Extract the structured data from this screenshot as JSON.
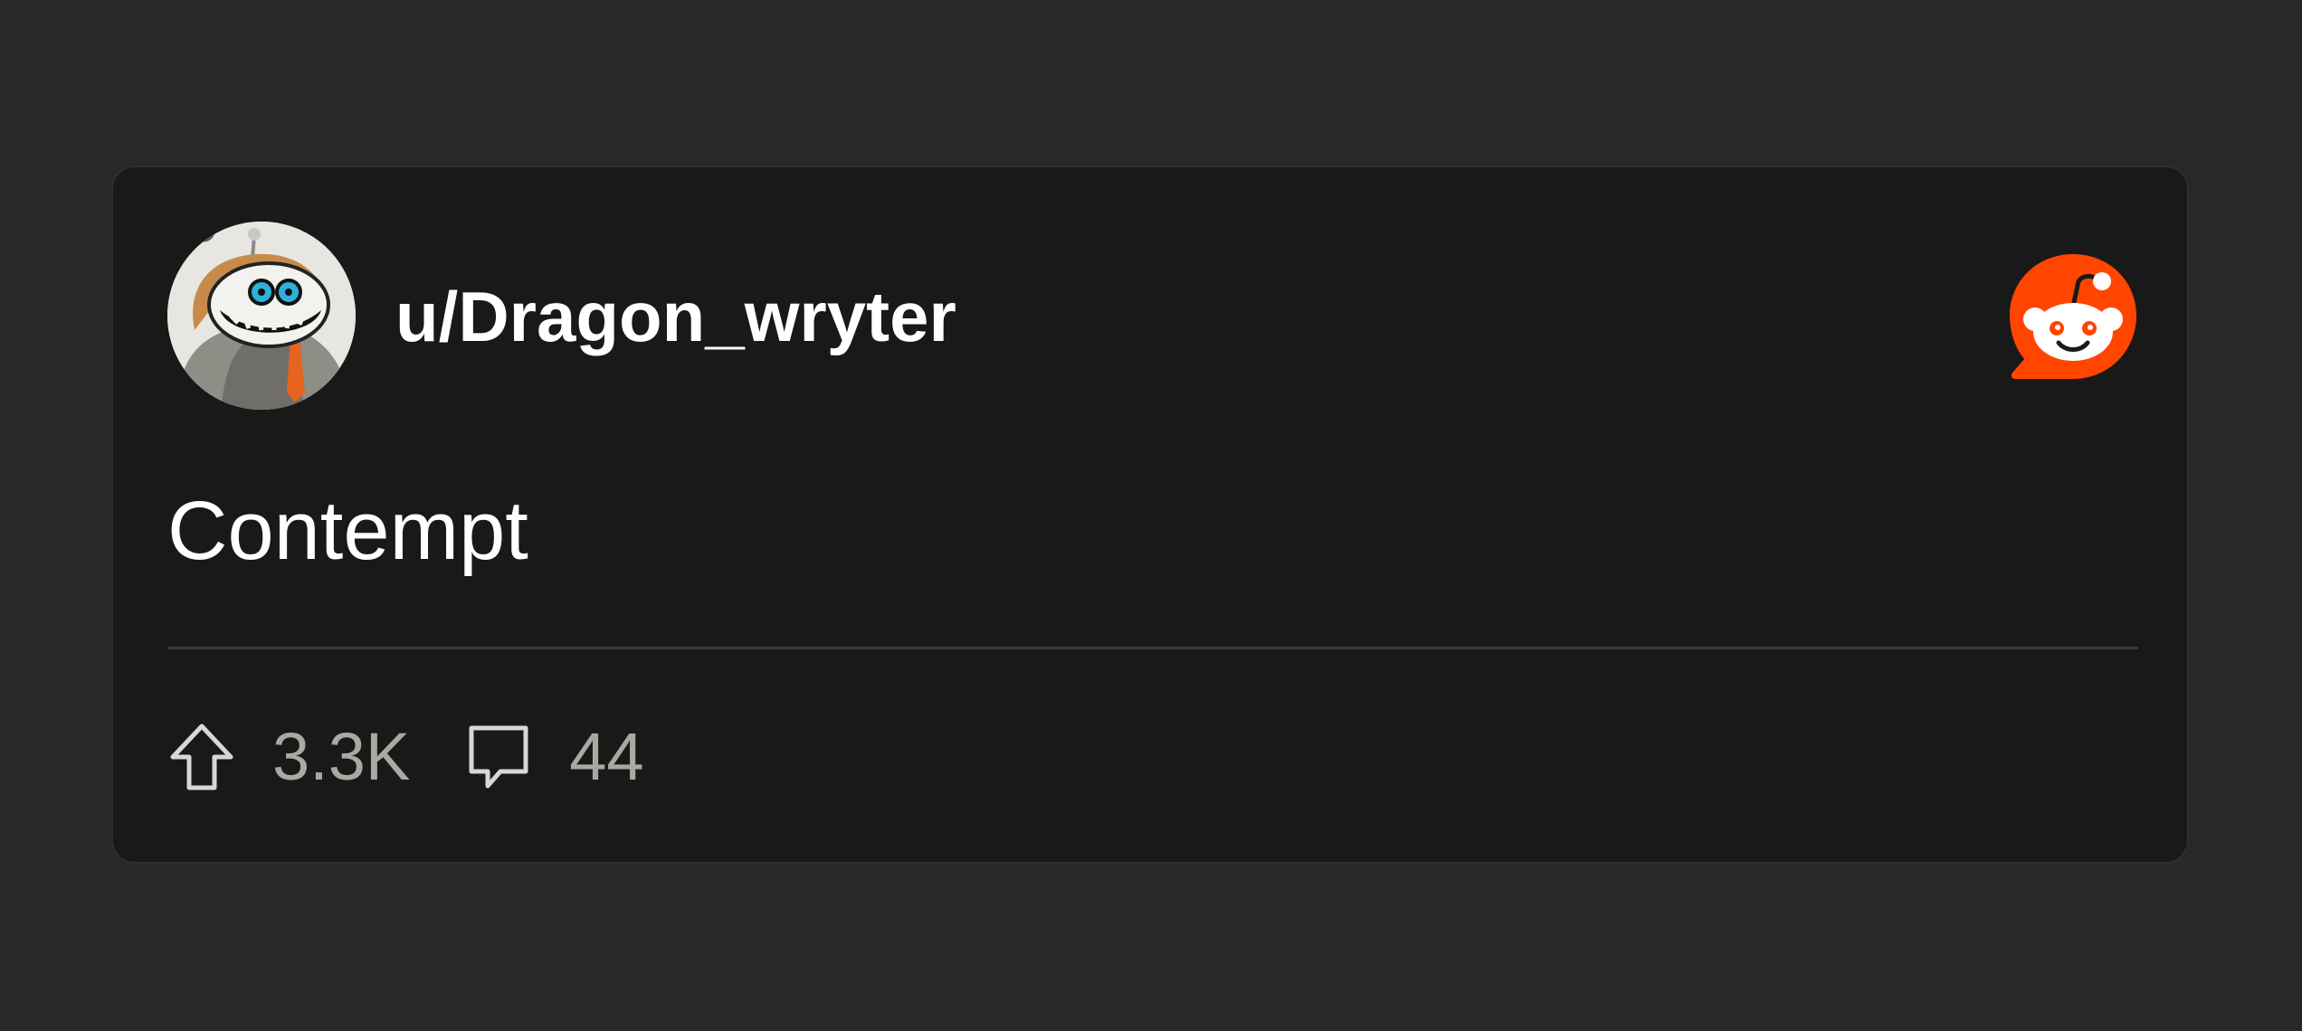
{
  "post": {
    "username": "u/Dragon_wryter",
    "title": "Contempt",
    "upvotes": "3.3K",
    "comments": "44"
  },
  "icons": {
    "avatar": "user-avatar",
    "brand": "reddit-logo-icon",
    "upvote": "upvote-arrow-icon",
    "comment": "comment-bubble-icon"
  },
  "colors": {
    "page_background": "#282828",
    "card_background": "#19191a",
    "text_primary": "#ffffff",
    "text_secondary": "#a9a9a1",
    "reddit_orange": "#ff4500",
    "divider": "#383838"
  }
}
